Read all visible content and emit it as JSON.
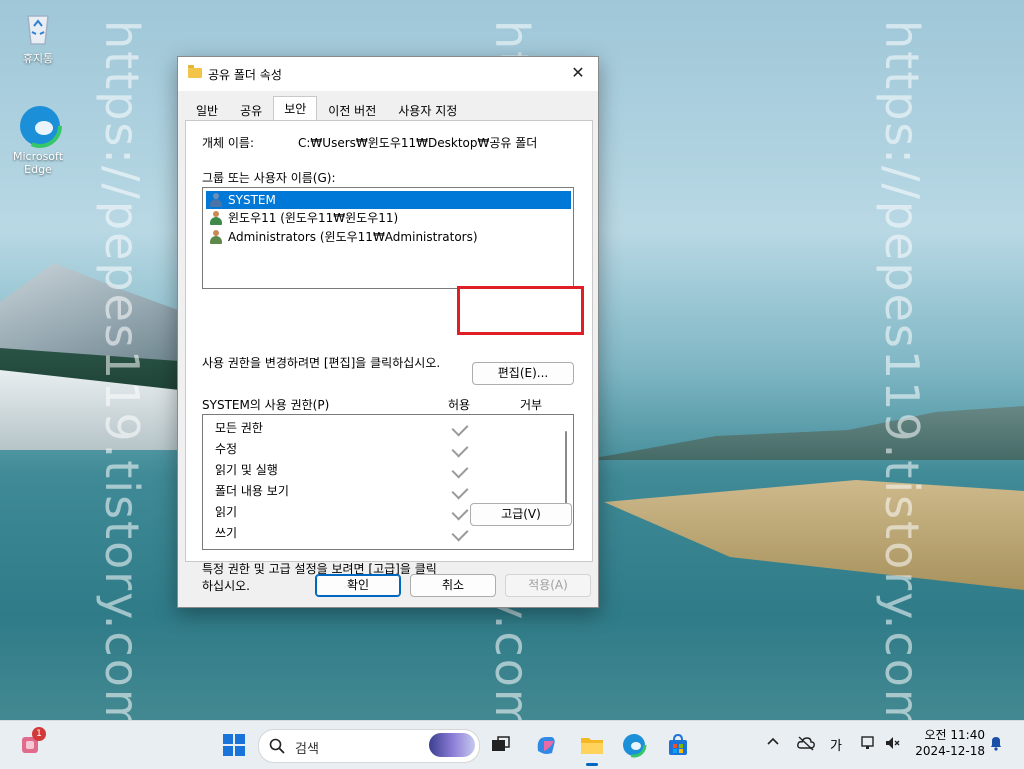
{
  "desktop": {
    "watermark": "https://pepes119.tistory.com/",
    "icons": [
      {
        "label": "휴지통"
      },
      {
        "label": "Microsoft Edge"
      }
    ]
  },
  "dialog": {
    "title": "공유 폴더 속성",
    "close_glyph": "✕",
    "tabs": [
      "일반",
      "공유",
      "보안",
      "이전 버전",
      "사용자 지정"
    ],
    "active_tab": "보안",
    "object_name_label": "개체 이름:",
    "object_name_value": "C:₩Users₩윈도우11₩Desktop₩공유 폴더",
    "group_label": "그룹 또는 사용자 이름(G):",
    "users": [
      {
        "name": "SYSTEM",
        "selected": true
      },
      {
        "name": "윈도우11 (윈도우11₩윈도우11)",
        "selected": false
      },
      {
        "name": "Administrators (윈도우11₩Administrators)",
        "selected": false
      }
    ],
    "edit_hint": "사용 권한을 변경하려면 [편집]을 클릭하십시오.",
    "edit_button": "편집(E)...",
    "perm_title": "SYSTEM의 사용 권한(P)",
    "perm_allow": "허용",
    "perm_deny": "거부",
    "permissions": [
      {
        "name": "모든 권한",
        "allow": true
      },
      {
        "name": "수정",
        "allow": true
      },
      {
        "name": "읽기 및 실행",
        "allow": true
      },
      {
        "name": "폴더 내용 보기",
        "allow": true
      },
      {
        "name": "읽기",
        "allow": true
      },
      {
        "name": "쓰기",
        "allow": true
      }
    ],
    "advanced_hint_1": "특정 권한 및 고급 설정을 보려면 [고급]을 클릭",
    "advanced_hint_2": "하십시오.",
    "advanced_button": "고급(V)",
    "ok_button": "확인",
    "cancel_button": "취소",
    "apply_button": "적용(A)"
  },
  "taskbar": {
    "search_placeholder": "검색",
    "notification_badge": "1",
    "ime": "가",
    "time": "오전 11:40",
    "date": "2024-12-18"
  },
  "colors": {
    "accent": "#0078d7",
    "highlight_box": "#e01e25"
  }
}
